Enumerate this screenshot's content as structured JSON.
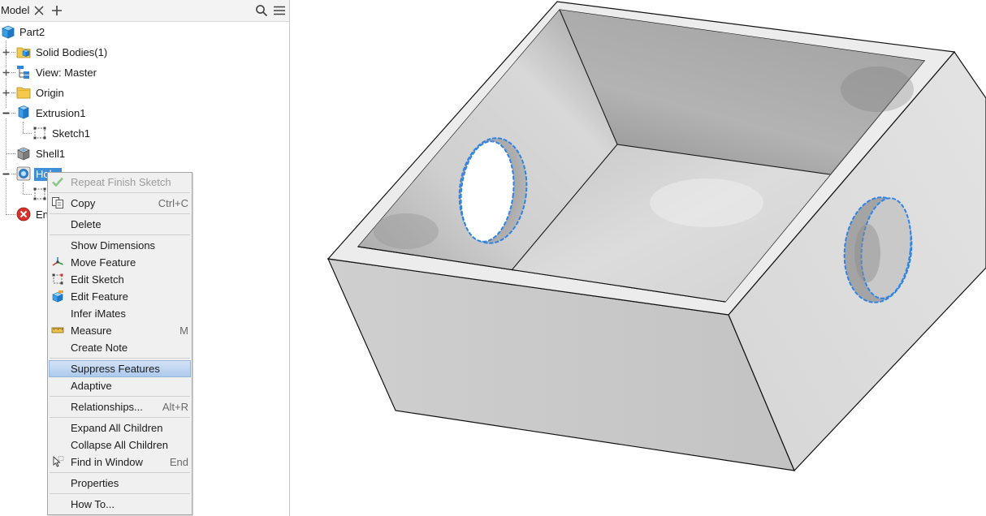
{
  "panel": {
    "tab_label": "Model",
    "icons": {
      "close": "close-icon",
      "add": "plus-icon",
      "search": "search-icon",
      "menu": "hamburger-menu-icon"
    }
  },
  "tree": {
    "root": {
      "label": "Part2",
      "icon": "part-icon"
    },
    "items": [
      {
        "label": "Solid Bodies(1)",
        "icon": "solid-bodies-folder-icon",
        "expander": "plus"
      },
      {
        "label": "View: Master",
        "icon": "view-rep-icon",
        "expander": "plus"
      },
      {
        "label": "Origin",
        "icon": "folder-icon",
        "expander": "plus"
      },
      {
        "label": "Extrusion1",
        "icon": "extrusion-icon",
        "expander": "minus"
      },
      {
        "label": "Sketch1",
        "icon": "sketch-icon"
      },
      {
        "label": "Shell1",
        "icon": "shell-icon"
      },
      {
        "label": "Hol",
        "icon": "hole-icon",
        "expander": "minus",
        "selected": true
      },
      {
        "label": "",
        "icon": "sketch-icon"
      },
      {
        "label": "En",
        "icon": "end-of-part-icon"
      }
    ]
  },
  "context_menu": {
    "items": [
      {
        "label": "Repeat Finish Sketch",
        "icon": "check-icon",
        "disabled": true
      },
      {
        "label": "Copy",
        "shortcut": "Ctrl+C",
        "icon": "copy-icon"
      },
      {
        "label": "Delete"
      },
      {
        "label": "Show Dimensions"
      },
      {
        "label": "Move Feature",
        "icon": "move-feature-icon"
      },
      {
        "label": "Edit Sketch",
        "icon": "edit-sketch-icon"
      },
      {
        "label": "Edit Feature",
        "icon": "edit-feature-icon"
      },
      {
        "label": "Infer iMates"
      },
      {
        "label": "Measure",
        "shortcut": "M",
        "icon": "measure-icon"
      },
      {
        "label": "Create Note"
      },
      {
        "label": "Suppress Features",
        "highlighted": true
      },
      {
        "label": "Adaptive"
      },
      {
        "label": "Relationships...",
        "shortcut": "Alt+R"
      },
      {
        "label": "Expand All Children"
      },
      {
        "label": "Collapse All Children"
      },
      {
        "label": "Find in Window",
        "shortcut": "End",
        "icon": "find-in-window-icon"
      },
      {
        "label": "Properties"
      },
      {
        "label": "How To..."
      }
    ]
  },
  "colors": {
    "selection": "#3f8fd8",
    "menu_highlight": "#abc8eb",
    "hole_edge": "#2e84e6",
    "error": "#d9302b"
  }
}
